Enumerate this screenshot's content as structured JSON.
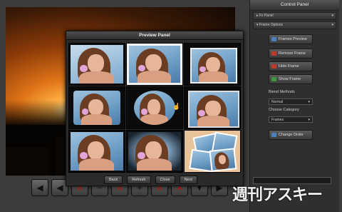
{
  "control_panel": {
    "title": "Control Panel",
    "accordion": [
      {
        "label": "Fx Panel",
        "icon": "triangle-right-icon"
      },
      {
        "label": "Frame Options",
        "icon": "triangle-down-icon"
      }
    ],
    "buttons": {
      "frames_preview": "Frames Preview",
      "remove_frame": "Remove Frame",
      "hide_frame": "Hide Frame",
      "show_frame": "Show Frame",
      "change_order": "Change Order"
    },
    "blend_methods_label": "Blend Methods",
    "blend_methods_value": "Normal",
    "choose_category_label": "Choose Category",
    "choose_category_value": "Frames"
  },
  "preview_panel": {
    "title": "Preview Panel",
    "buttons": {
      "back": "Back",
      "refresh": "Refresh",
      "close": "Close",
      "next": "Next"
    }
  },
  "watermark": "週刊アスキー",
  "colors": {
    "accent_blue": "#4a7fc0",
    "remove_red": "#c0392b",
    "show_green": "#3c9a3c"
  }
}
